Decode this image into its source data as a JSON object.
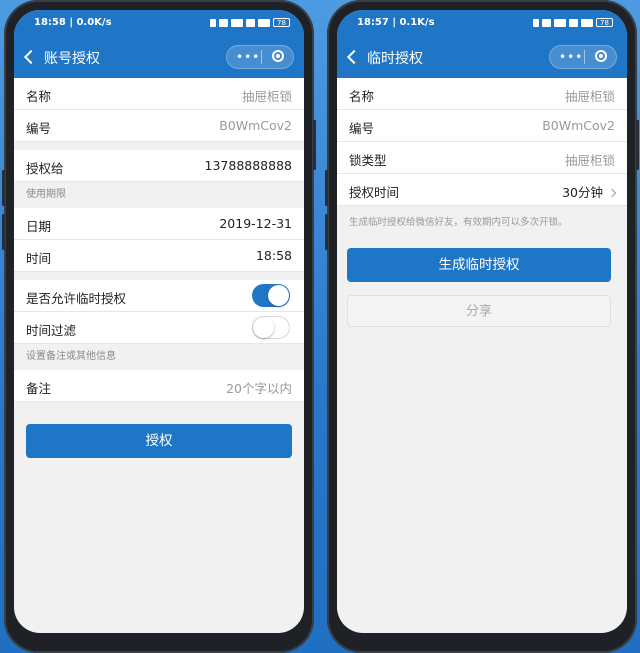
{
  "left_phone": {
    "status": {
      "time": "18:58 | 0.0K/s",
      "battery": "78"
    },
    "nav": {
      "title": "账号授权",
      "dots": "•••"
    },
    "rows": {
      "name": {
        "label": "名称",
        "value": "抽屉柜锁"
      },
      "code": {
        "label": "编号",
        "value": "B0WmCov2"
      },
      "grant_to": {
        "label": "授权给",
        "value": "13788888888"
      }
    },
    "validity_section": "使用期限",
    "date": {
      "label": "日期",
      "value": "2019-12-31"
    },
    "time": {
      "label": "时间",
      "value": "18:58"
    },
    "allow_temp": {
      "label": "是否允许临时授权",
      "on": true
    },
    "time_filter": {
      "label": "时间过滤",
      "on": false
    },
    "remark_section": "设置备注或其他信息",
    "remark": {
      "label": "备注",
      "placeholder": "20个字以内"
    },
    "submit_label": "授权"
  },
  "right_phone": {
    "status": {
      "time": "18:57 | 0.1K/s",
      "battery": "78"
    },
    "nav": {
      "title": "临时授权",
      "dots": "•••"
    },
    "rows": {
      "name": {
        "label": "名称",
        "value": "抽屉柜锁"
      },
      "code": {
        "label": "编号",
        "value": "B0WmCov2"
      },
      "lock_type": {
        "label": "锁类型",
        "value": "抽屉柜锁"
      },
      "duration": {
        "label": "授权时间",
        "value": "30分钟"
      }
    },
    "hint": "生成临时授权给微信好友，有效期内可以多次开锁。",
    "generate_label": "生成临时授权",
    "share_label": "分享"
  },
  "colors": {
    "accent": "#1f76c7",
    "background": "#2a78cb"
  }
}
